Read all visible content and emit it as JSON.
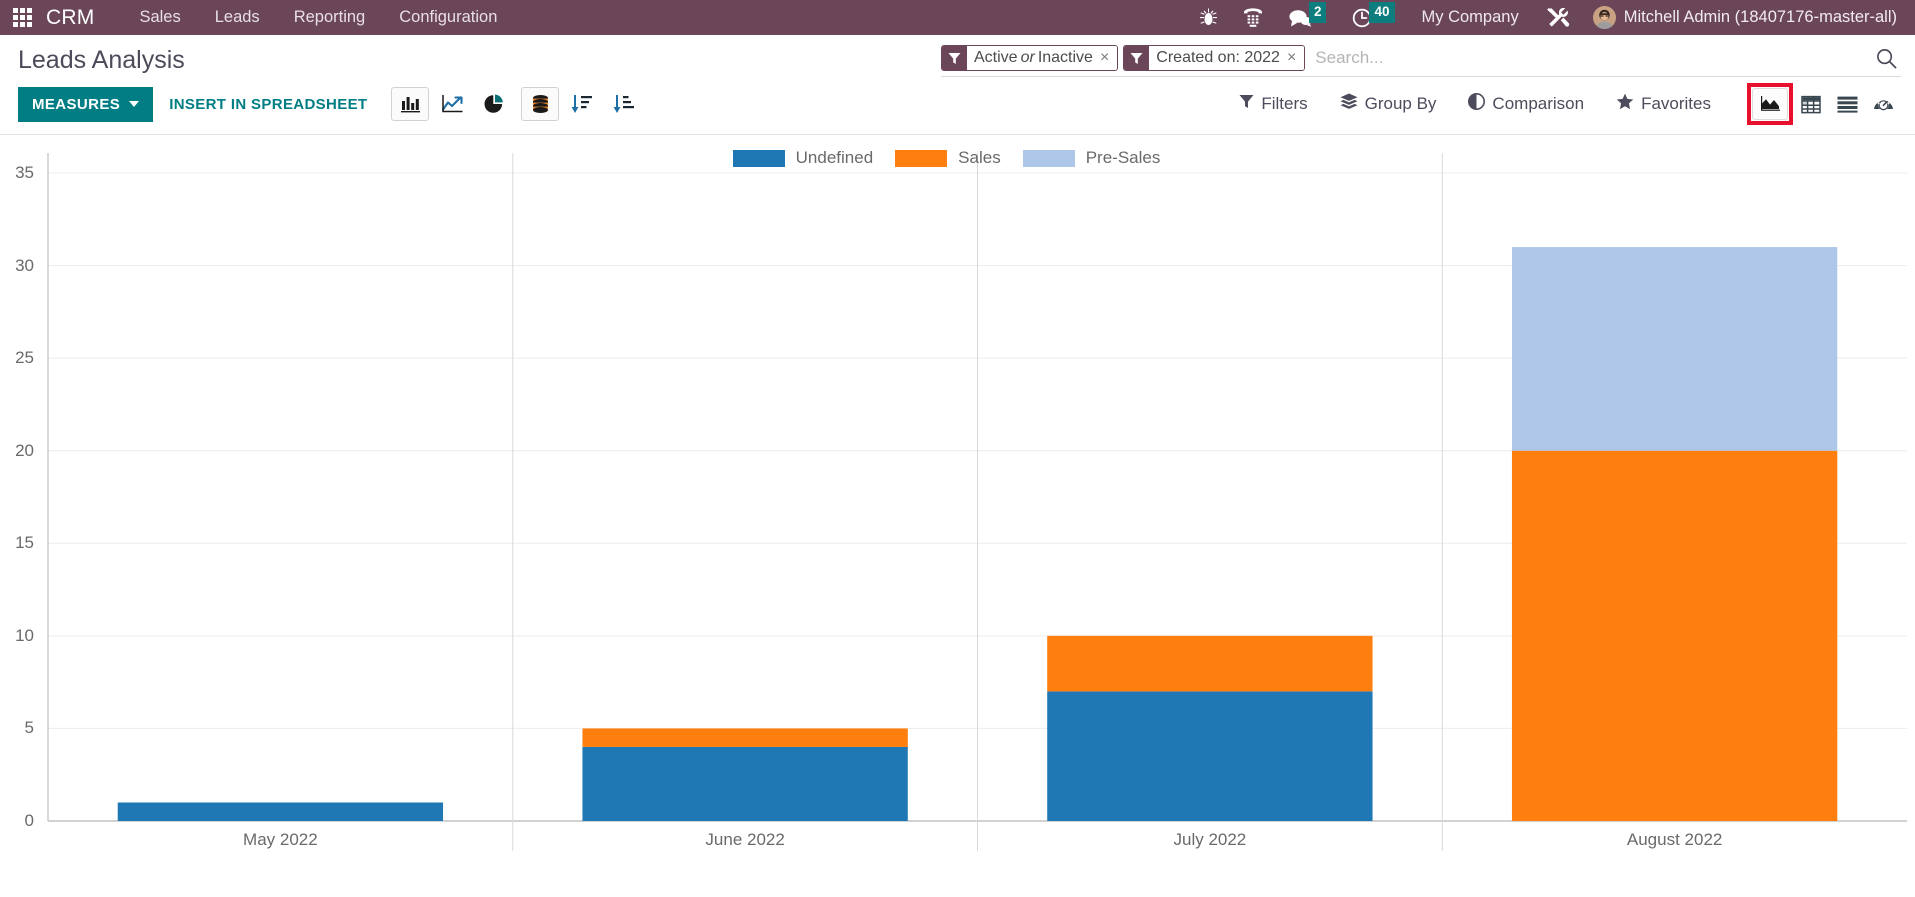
{
  "navbar": {
    "apps_icon": "apps-grid-icon",
    "brand": "CRM",
    "menu": [
      {
        "label": "Sales"
      },
      {
        "label": "Leads"
      },
      {
        "label": "Reporting"
      },
      {
        "label": "Configuration"
      }
    ],
    "icons": [
      {
        "name": "bug-icon"
      },
      {
        "name": "dialpad-phone-icon"
      },
      {
        "name": "chat-bubble-icon",
        "badge": "2"
      },
      {
        "name": "clock-activity-icon",
        "badge": "40"
      }
    ],
    "company": "My Company",
    "settings_icon": "tools-wrench-icon",
    "avatar": "user-avatar",
    "username": "Mitchell Admin (18407176-master-all)",
    "badge_color": "#0d7d7d",
    "background_color": "#6b4659"
  },
  "control_panel": {
    "page_title": "Leads Analysis",
    "facets": [
      {
        "icon": "filter-icon",
        "label_prefix": "Active",
        "label_em": "or",
        "label_suffix": "Inactive",
        "remove": "×"
      },
      {
        "icon": "filter-icon",
        "label_prefix": "Created on: 2022",
        "label_em": "",
        "label_suffix": "",
        "remove": "×"
      }
    ],
    "search": {
      "value": "",
      "placeholder": "Search...",
      "icon": "search-icon"
    },
    "measures_label": "MEASURES",
    "insert_spreadsheet_label": "INSERT IN SPREADSHEET",
    "chart_type_buttons": [
      {
        "name": "bar-chart-icon",
        "active": true
      },
      {
        "name": "line-chart-icon",
        "active": false
      },
      {
        "name": "pie-chart-icon",
        "active": false
      }
    ],
    "option_buttons": [
      {
        "name": "stacked-database-icon",
        "active": true
      },
      {
        "name": "sort-descending-icon",
        "active": false
      },
      {
        "name": "sort-ascending-icon",
        "active": false
      }
    ],
    "menus": [
      {
        "icon": "filter-icon",
        "label": "Filters"
      },
      {
        "icon": "layers-icon",
        "label": "Group By"
      },
      {
        "icon": "half-circle-icon",
        "label": "Comparison"
      },
      {
        "icon": "star-icon",
        "label": "Favorites"
      }
    ],
    "views": [
      {
        "name": "graph-view-icon",
        "active": true,
        "highlighted": true
      },
      {
        "name": "pivot-view-icon",
        "active": false,
        "highlighted": false
      },
      {
        "name": "list-view-icon",
        "active": false,
        "highlighted": false
      },
      {
        "name": "dashboard-view-icon",
        "active": false,
        "highlighted": false
      }
    ],
    "highlight_color": "#e8112d",
    "accent_color": "#017e84"
  },
  "chart_data": {
    "type": "bar",
    "stacked": true,
    "title": "",
    "xlabel": "",
    "ylabel": "",
    "categories": [
      "May 2022",
      "June 2022",
      "July 2022",
      "August 2022"
    ],
    "series": [
      {
        "name": "Undefined",
        "color": "#1f77b4",
        "values": [
          1,
          4,
          7,
          0
        ]
      },
      {
        "name": "Sales",
        "color": "#ff7f0e",
        "values": [
          0,
          1,
          3,
          20
        ]
      },
      {
        "name": "Pre-Sales",
        "color": "#aec7e8",
        "values": [
          0,
          0,
          0,
          11
        ]
      }
    ],
    "totals": [
      1,
      5,
      10,
      31
    ],
    "ylim": [
      0,
      35
    ],
    "yticks": [
      0,
      5,
      10,
      15,
      20,
      25,
      30,
      35
    ],
    "grid": true,
    "legend_position": "top"
  }
}
